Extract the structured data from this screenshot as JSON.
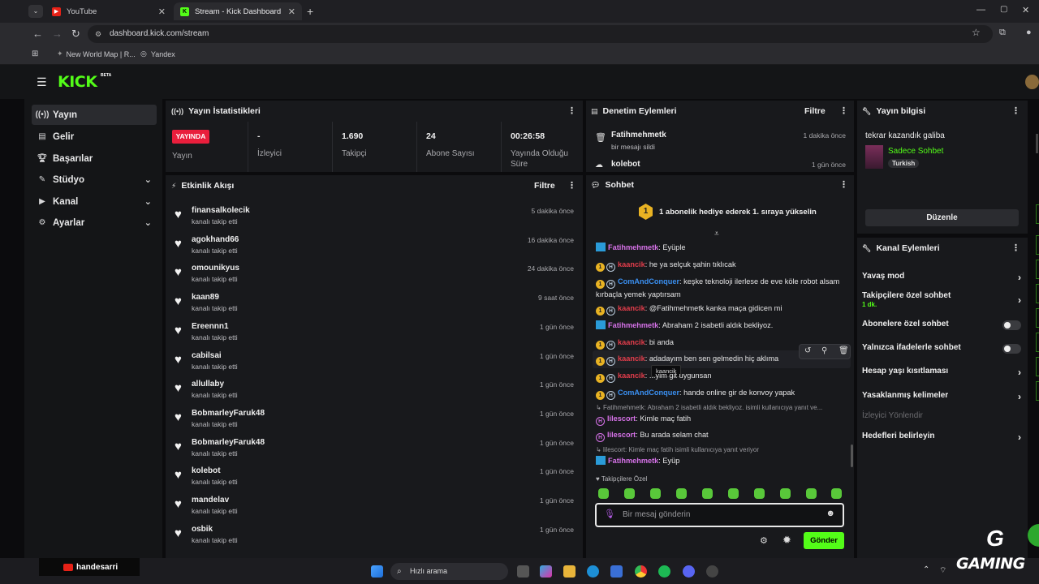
{
  "browser": {
    "tabs": [
      {
        "title": "YouTube"
      },
      {
        "title": "Stream - Kick Dashboard"
      }
    ],
    "url": "dashboard.kick.com/stream",
    "bookmarks": [
      "New World Map | R...",
      "Yandex"
    ]
  },
  "app": {
    "logo": "KICK",
    "beta": "BETA"
  },
  "sidebar": {
    "items": [
      {
        "label": "Yayın"
      },
      {
        "label": "Gelir"
      },
      {
        "label": "Başarılar"
      },
      {
        "label": "Stüdyo"
      },
      {
        "label": "Kanal"
      },
      {
        "label": "Ayarlar"
      }
    ]
  },
  "stats": {
    "title": "Yayın İstatistikleri",
    "live_badge": "YAYINDA",
    "live_label": "Yayın",
    "items": [
      {
        "value": "-",
        "label": "İzleyici"
      },
      {
        "value": "1.690",
        "label": "Takipçi"
      },
      {
        "value": "24",
        "label": "Abone Sayısı"
      },
      {
        "value": "00:26:58",
        "label": "Yayında Olduğu Süre"
      }
    ]
  },
  "activity": {
    "title": "Etkinlik Akışı",
    "filter": "Filtre",
    "events": [
      {
        "name": "finansalkolecik",
        "sub": "kanalı takip etti",
        "time": "5 dakika önce"
      },
      {
        "name": "agokhand66",
        "sub": "kanalı takip etti",
        "time": "16 dakika önce"
      },
      {
        "name": "omounikyus",
        "sub": "kanalı takip etti",
        "time": "24 dakika önce"
      },
      {
        "name": "kaan89",
        "sub": "kanalı takip etti",
        "time": "9 saat önce"
      },
      {
        "name": "Ereennn1",
        "sub": "kanalı takip etti",
        "time": "1 gün önce"
      },
      {
        "name": "cabilsai",
        "sub": "kanalı takip etti",
        "time": "1 gün önce"
      },
      {
        "name": "allullaby",
        "sub": "kanalı takip etti",
        "time": "1 gün önce"
      },
      {
        "name": "BobmarleyFaruk48",
        "sub": "kanalı takip etti",
        "time": "1 gün önce"
      },
      {
        "name": "BobmarleyFaruk48",
        "sub": "kanalı takip etti",
        "time": "1 gün önce"
      },
      {
        "name": "kolebot",
        "sub": "kanalı takip etti",
        "time": "1 gün önce"
      },
      {
        "name": "mandelav",
        "sub": "kanalı takip etti",
        "time": "1 gün önce"
      },
      {
        "name": "osbik",
        "sub": "kanalı takip etti",
        "time": "1 gün önce"
      }
    ]
  },
  "moderation": {
    "title": "Denetim Eylemleri",
    "filter": "Filtre",
    "items": [
      {
        "name": "Fatihmehmetk",
        "sub": "bir mesajı sildi",
        "time": "1 dakika önce"
      },
      {
        "name": "kolebot",
        "time": "1 gün önce"
      }
    ]
  },
  "chat": {
    "title": "Sohbet",
    "gift_banner": "1 abonelik hediye ederek 1. sıraya yükselin",
    "messages": [
      {
        "user": "Fatihmehmetk",
        "text": ": Eyüple"
      },
      {
        "user": "kaancik",
        "text": ": he ya selçuk şahin tıklıcak"
      },
      {
        "user": "ComAndConquer",
        "text": ": keşke teknoloji ilerlese de eve köle robot alsam kırbaçla yemek yaptırsam"
      },
      {
        "user": "kaancik",
        "text": ": @Fatihmehmetk kanka maça gidicen mi"
      },
      {
        "user": "Fatihmehmetk",
        "text": ": Abraham 2 isabetli aldık bekliyoz."
      },
      {
        "user": "kaancik",
        "text": ": bi anda"
      },
      {
        "user": "kaancik",
        "text": ": adadayım ben sen gelmedin hiç aklıma"
      },
      {
        "user": "kaancik",
        "text": ": ...yim git uygunsan"
      },
      {
        "user": "ComAndConquer",
        "text": ": hande online gir de konvoy yapak"
      },
      {
        "user": "lilescort",
        "text": ": Kimle maç fatih"
      },
      {
        "user": "lilescort",
        "text": ": Bu arada selam chat"
      },
      {
        "user": "Fatihmehmetk",
        "text": ": Eyüp"
      }
    ],
    "replies": [
      "Fatihmehmetk: Abraham 2 isabetli aldık bekliyoz. isimli kullanıcıya yanıt ve...",
      "lilescort: Kimle maç fatih isimli kullanıcıya yanıt veriyor"
    ],
    "tooltip": "kaancik",
    "followers_only": "Takipçilere Özel",
    "input_placeholder": "Bir mesaj gönderin",
    "send": "Gönder"
  },
  "stream_info": {
    "title": "Yayın bilgisi",
    "stream_title": "tekrar kazandık galiba",
    "category": "Sadece Sohbet",
    "language": "Turkish",
    "edit": "Düzenle"
  },
  "channel_actions": {
    "title": "Kanal Eylemleri",
    "items": [
      {
        "label": "Yavaş mod",
        "type": "chevron"
      },
      {
        "label": "Takipçilere özel sohbet",
        "sub": "1 dk.",
        "type": "chevron"
      },
      {
        "label": "Abonelere özel sohbet",
        "type": "toggle"
      },
      {
        "label": "Yalnızca ifadelerle sohbet",
        "type": "toggle"
      },
      {
        "label": "Hesap yaşı kısıtlaması",
        "type": "chevron"
      },
      {
        "label": "Yasaklanmış kelimeler",
        "type": "chevron"
      },
      {
        "label": "İzleyici Yönlendir",
        "type": "disabled"
      },
      {
        "label": "Hedefleri belirleyin",
        "type": "chevron"
      }
    ]
  },
  "taskbar": {
    "search": "Hızlı arama",
    "youtube_user": "handesarri",
    "watermark": "GAMING"
  },
  "colors": {
    "accent": "#53fc18",
    "live": "#e91e3c",
    "panel": "#18191c",
    "bg": "#0b0b0d"
  }
}
